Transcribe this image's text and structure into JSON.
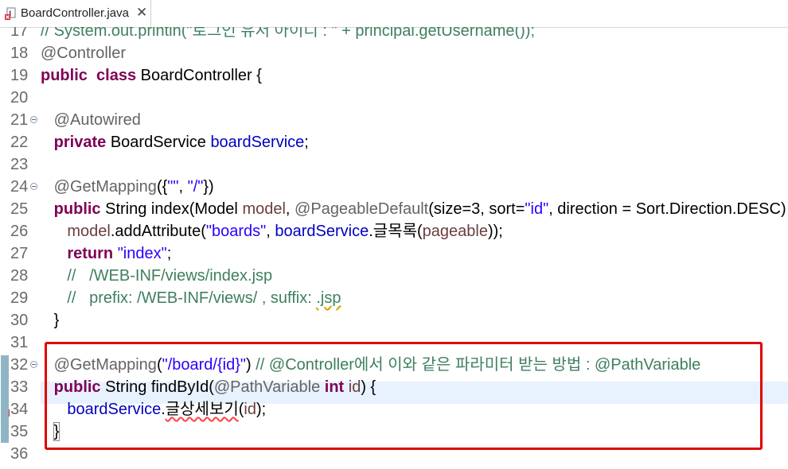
{
  "tab": {
    "title": "BoardController.java",
    "close_glyph": "✕"
  },
  "lines": [
    {
      "n": "17",
      "tokens": [
        [
          "cmt",
          "// System.out.println(\"로그인 유저 아이디 : \" + principal.getUsername());"
        ]
      ]
    },
    {
      "n": "18",
      "tokens": [
        [
          "ann",
          "@Controller"
        ]
      ]
    },
    {
      "n": "19",
      "tokens": [
        [
          "kw",
          "public"
        ],
        [
          "",
          "  "
        ],
        [
          "kw",
          "class"
        ],
        [
          "",
          " BoardController {"
        ]
      ]
    },
    {
      "n": "20",
      "tokens": []
    },
    {
      "n": "21",
      "fold": true,
      "tokens": [
        [
          "",
          "   "
        ],
        [
          "ann",
          "@Autowired"
        ]
      ]
    },
    {
      "n": "22",
      "tokens": [
        [
          "",
          "   "
        ],
        [
          "kw",
          "private"
        ],
        [
          "",
          " BoardService "
        ],
        [
          "fld",
          "boardService"
        ],
        [
          "",
          ";"
        ]
      ]
    },
    {
      "n": "23",
      "tokens": []
    },
    {
      "n": "24",
      "fold": true,
      "tokens": [
        [
          "",
          "   "
        ],
        [
          "ann",
          "@GetMapping"
        ],
        [
          "",
          "({"
        ],
        [
          "str",
          "\"\""
        ],
        [
          "",
          ", "
        ],
        [
          "str",
          "\"/\""
        ],
        [
          "",
          "})"
        ]
      ]
    },
    {
      "n": "25",
      "tokens": [
        [
          "",
          "   "
        ],
        [
          "kw",
          "public"
        ],
        [
          "",
          " String index(Model "
        ],
        [
          "var",
          "model"
        ],
        [
          "",
          ", "
        ],
        [
          "ann",
          "@PageableDefault"
        ],
        [
          "",
          "(size=3, sort="
        ],
        [
          "str",
          "\"id\""
        ],
        [
          "",
          ", direction = Sort.Direction.DESC) Pageable "
        ],
        [
          "var",
          "pageable"
        ],
        [
          "",
          ") {"
        ]
      ]
    },
    {
      "n": "26",
      "tokens": [
        [
          "",
          "      "
        ],
        [
          "var",
          "model"
        ],
        [
          "",
          ".addAttribute("
        ],
        [
          "str",
          "\"boards\""
        ],
        [
          "",
          ", "
        ],
        [
          "fld",
          "boardService"
        ],
        [
          "",
          ".글목록("
        ],
        [
          "var",
          "pageable"
        ],
        [
          "",
          "));"
        ]
      ]
    },
    {
      "n": "27",
      "tokens": [
        [
          "",
          "      "
        ],
        [
          "kw",
          "return"
        ],
        [
          "",
          " "
        ],
        [
          "str",
          "\"index\""
        ],
        [
          "",
          ";"
        ]
      ]
    },
    {
      "n": "28",
      "tokens": [
        [
          "",
          "      "
        ],
        [
          "cmt",
          "//   /WEB-INF/views/index.jsp"
        ]
      ]
    },
    {
      "n": "29",
      "tokens": [
        [
          "",
          "      "
        ],
        [
          "cmt",
          "//   prefix: /WEB-INF/views/ , suffix: "
        ],
        [
          "cmtsq",
          ".jsp"
        ]
      ]
    },
    {
      "n": "30",
      "tokens": [
        [
          "",
          "   }"
        ]
      ]
    },
    {
      "n": "31",
      "tokens": []
    },
    {
      "n": "32",
      "fold": true,
      "tokens": [
        [
          "",
          "   "
        ],
        [
          "ann",
          "@GetMapping"
        ],
        [
          "",
          "("
        ],
        [
          "str",
          "\"/board/{id}\""
        ],
        [
          "",
          ") "
        ],
        [
          "cmt",
          "// @Controller에서 이와 같은 파라미터 받는 방법 : @PathVariable"
        ]
      ]
    },
    {
      "n": "33",
      "tokens": [
        [
          "",
          "   "
        ],
        [
          "kw",
          "public"
        ],
        [
          "",
          " String findById("
        ],
        [
          "ann",
          "@PathVariable"
        ],
        [
          "",
          " "
        ],
        [
          "kw",
          "int"
        ],
        [
          "",
          " "
        ],
        [
          "var",
          "id"
        ],
        [
          "",
          ") {"
        ]
      ]
    },
    {
      "n": "34",
      "tokens": [
        [
          "",
          "      "
        ],
        [
          "fld",
          "boardService"
        ],
        [
          "",
          "."
        ],
        [
          "sq",
          "글상세보기"
        ],
        [
          "",
          "("
        ],
        [
          "var",
          "id"
        ],
        [
          "",
          ");"
        ]
      ]
    },
    {
      "n": "35",
      "tokens": [
        [
          "",
          "   "
        ],
        [
          "caret",
          "}"
        ]
      ]
    },
    {
      "n": "36",
      "tokens": []
    }
  ],
  "colors": {
    "highlight_box": "#e00000",
    "keyword": "#7f0055",
    "string": "#2a00ff",
    "comment": "#3f7f5f",
    "field": "#0000c0"
  }
}
